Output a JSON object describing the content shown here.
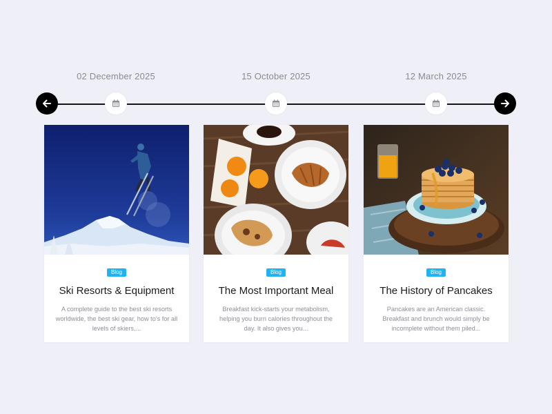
{
  "timeline": {
    "dates": [
      "02 December 2025",
      "15 October 2025",
      "12 March 2025"
    ],
    "prev_icon": "arrow-left-icon",
    "next_icon": "arrow-right-icon",
    "marker_icon": "calendar-icon"
  },
  "cards": [
    {
      "image": "skier-jumping-snowy-mountain",
      "tag": "Blog",
      "title": "Ski Resorts & Equipment",
      "description": "A complete guide to the best ski resorts worldwide, the best ski gear, how to's for all levels of skiers,..."
    },
    {
      "image": "breakfast-table-croissant-oranges",
      "tag": "Blog",
      "title": "The Most Important Meal",
      "description": "Breakfast kick-starts your metabolism, helping you burn calories throughout the day. It also gives you..."
    },
    {
      "image": "pancake-stack-blueberries-syrup",
      "tag": "Blog",
      "title": "The History of Pancakes",
      "description": "Pancakes are an American classic. Breakfast and brunch would simply be incomplete without them piled..."
    }
  ],
  "colors": {
    "background": "#efeff8",
    "tag": "#1fb3f3",
    "nav_button": "#000000"
  }
}
